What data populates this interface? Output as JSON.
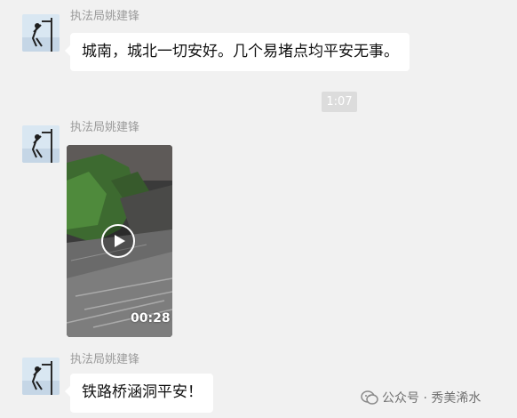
{
  "messages": [
    {
      "sender": "执法局姚建锋",
      "text": "城南，城北一切安好。几个易堵点均平安无事。"
    },
    {
      "sender": "执法局姚建锋",
      "video": {
        "duration": "00:28"
      }
    },
    {
      "sender": "执法局姚建锋",
      "text": "铁路桥涵洞平安！"
    }
  ],
  "timestamp": "1:07",
  "watermark": {
    "text": "公众号 · 秀美浠水",
    "icon": "wechat-official-account-icon"
  },
  "colors": {
    "background": "#f1f1f1",
    "bubble": "#ffffff",
    "sender": "#9a9a9a"
  }
}
